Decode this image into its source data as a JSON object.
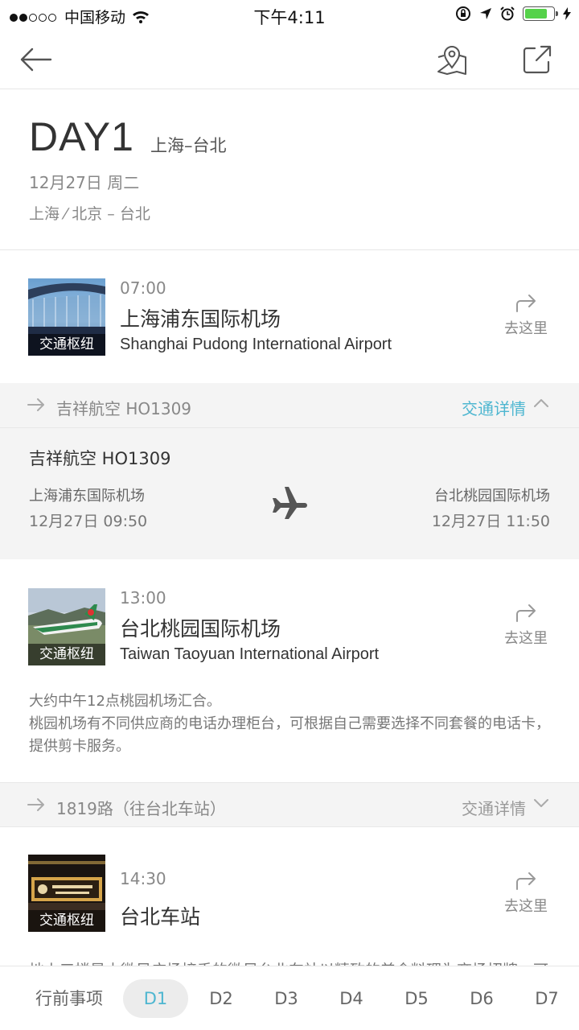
{
  "status_bar": {
    "carrier": "中国移动",
    "time": "下午4:11"
  },
  "colors": {
    "accent": "#4db6d0",
    "battery": "#55d24a"
  },
  "nav": {
    "back_icon": "back-arrow-icon",
    "map_icon": "map-pin-icon",
    "share_icon": "share-icon"
  },
  "day": {
    "title": "DAY1",
    "route": "上海–台北",
    "date": "12月27日 周二",
    "cities": "上海 ⁄ 北京 – 台北"
  },
  "pois": [
    {
      "time": "07:00",
      "name": "上海浦东国际机场",
      "name_en": "Shanghai Pudong International Airport",
      "tag": "交通枢纽",
      "goto": "去这里"
    },
    {
      "time": "13:00",
      "name": "台北桃园国际机场",
      "name_en": "Taiwan Taoyuan International Airport",
      "tag": "交通枢纽",
      "goto": "去这里"
    },
    {
      "time": "14:30",
      "name": "台北车站",
      "name_en": "",
      "tag": "交通枢纽",
      "goto": "去这里"
    }
  ],
  "transports": [
    {
      "label": "吉祥航空 HO1309",
      "detail": "交通详情",
      "expanded": true
    },
    {
      "label": "1819路（往台北车站）",
      "detail": "交通详情",
      "expanded": false
    }
  ],
  "flight": {
    "name": "吉祥航空 HO1309",
    "from": "上海浦东国际机场",
    "from_time": "12月27日 09:50",
    "to": "台北桃园国际机场",
    "to_time": "12月27日 11:50"
  },
  "note": {
    "line1": "大约中午12点桃园机场汇合。",
    "line2": "桃园机场有不同供应商的电话办理柜台，可根据自己需要选择不同套餐的电话卡，提供剪卡服务。"
  },
  "peek_text": "地上三楼是由微风广场接手的微风台北车站以精致的美食料理为商场招牌，可",
  "tabs": [
    {
      "label": "行前事项",
      "active": false
    },
    {
      "label": "D1",
      "active": true
    },
    {
      "label": "D2",
      "active": false
    },
    {
      "label": "D3",
      "active": false
    },
    {
      "label": "D4",
      "active": false
    },
    {
      "label": "D5",
      "active": false
    },
    {
      "label": "D6",
      "active": false
    },
    {
      "label": "D7",
      "active": false
    }
  ]
}
